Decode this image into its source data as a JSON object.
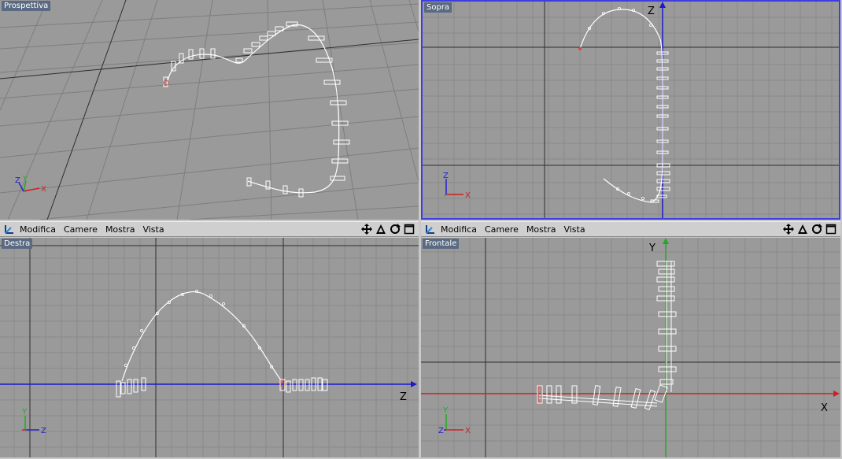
{
  "viewports": {
    "perspective": {
      "title": "Prospettiva"
    },
    "top": {
      "title": "Sopra"
    },
    "right": {
      "title": "Destra"
    },
    "front": {
      "title": "Frontale"
    }
  },
  "menu": {
    "edit": "Modifica",
    "cameras": "Camere",
    "display": "Mostra",
    "view": "Vista"
  },
  "axis_labels": {
    "x": "X",
    "y": "Y",
    "z": "Z"
  },
  "colors": {
    "viewport_bg": "#9a9a9a",
    "grid": "#8a8a8a",
    "grid_major": "#3a3a3a",
    "x_axis": "#cc2222",
    "y_axis": "#22aa22",
    "z_axis": "#2222cc",
    "active_border": "#3d3de0",
    "spline": "#ffffff"
  },
  "icons": {
    "tool": "axis-tool-icon",
    "move": "move-icon",
    "zoom": "zoom-icon",
    "rotate": "rotate-icon",
    "maximize": "maximize-icon"
  }
}
